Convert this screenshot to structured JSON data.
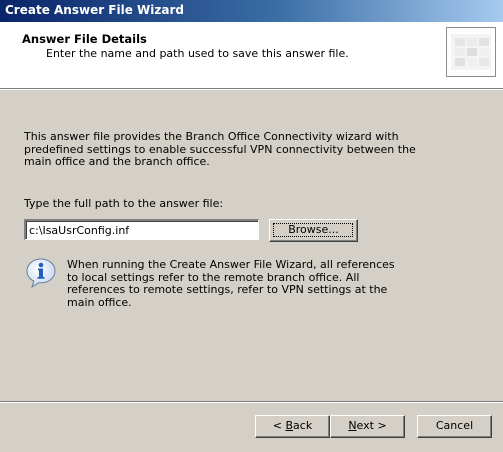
{
  "window": {
    "title": "Create Answer File Wizard"
  },
  "header": {
    "title": "Answer File Details",
    "subtitle": "Enter the name and path used to save this answer file."
  },
  "body": {
    "intro": "This answer file provides the Branch Office Connectivity wizard with predefined settings to enable successful VPN connectivity between the main office and the branch office.",
    "path_label": "Type the full path to the answer file:",
    "path_value": "c:\\IsaUsrConfig.inf",
    "browse_label": "Browse...",
    "info_text": "When running the Create Answer File Wizard, all references to local settings refer to the remote branch office.  All references to remote settings, refer to VPN settings at the main office."
  },
  "footer": {
    "back_label": "< Back",
    "next_label": "Next >",
    "cancel_label": "Cancel"
  },
  "colors": {
    "titlebar_start": "#0a246a",
    "titlebar_end": "#a6caf0",
    "dialog_face": "#d4d0c8",
    "info_icon": "#1f5fbf"
  },
  "icons": {
    "info": "info-icon",
    "wizard_graphic": "wizard-graphic-icon"
  }
}
